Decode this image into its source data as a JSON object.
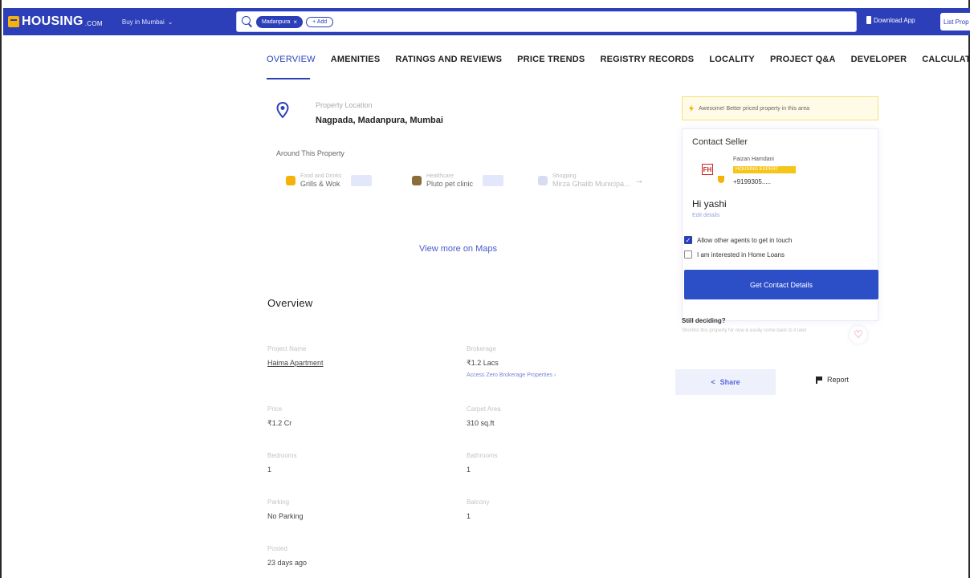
{
  "header": {
    "logo": "HOUSING",
    "logo_suffix": ".COM",
    "city_select": "Buy in Mumbai",
    "search_chip": "Madanpura",
    "search_add": "+ Add",
    "download_app": "Download App",
    "list_property": "List Prop"
  },
  "tabs": [
    {
      "label": "OVERVIEW",
      "active": true
    },
    {
      "label": "AMENITIES"
    },
    {
      "label": "RATINGS AND REVIEWS"
    },
    {
      "label": "PRICE TRENDS"
    },
    {
      "label": "REGISTRY RECORDS"
    },
    {
      "label": "LOCALITY"
    },
    {
      "label": "PROJECT Q&A"
    },
    {
      "label": "DEVELOPER"
    },
    {
      "label": "CALCULATOR"
    }
  ],
  "location": {
    "label": "Property Location",
    "value": "Nagpada, Madanpura, Mumbai",
    "around_title": "Around This Property",
    "pois": [
      {
        "category": "Food and Drinks",
        "name": "Grills & Wok"
      },
      {
        "category": "Healthcare",
        "name": "Pluto pet clinic"
      },
      {
        "category": "Shopping",
        "name": "Mirza Ghalib Municipa..."
      }
    ],
    "view_maps": "View more on Maps"
  },
  "overview": {
    "title": "Overview",
    "fields": [
      {
        "label": "Project Name",
        "value": "Haima Apartment"
      },
      {
        "label": "Brokerage",
        "value": "₹1.2 Lacs",
        "sub": "Access Zero Brokerage Properties ›"
      },
      {
        "label": "Price",
        "value": "₹1.2 Cr"
      },
      {
        "label": "Carpet Area",
        "value": "310 sq.ft"
      },
      {
        "label": "Bedrooms",
        "value": "1"
      },
      {
        "label": "Bathrooms",
        "value": "1"
      },
      {
        "label": "Parking",
        "value": "No Parking"
      },
      {
        "label": "Balcony",
        "value": "1"
      },
      {
        "label": "Posted",
        "value": "23 days ago"
      }
    ]
  },
  "sidebar": {
    "banner": "Awesome! Better priced property in this area",
    "contact_title": "Contact Seller",
    "seller_logo": "FH",
    "seller_name": "Faizan Hamdani",
    "seller_badge": "HOUSING EXPERT",
    "seller_phone": "+9199305.....",
    "greeting": "Hi yashi",
    "edit_details": "Edit details",
    "check_agents": "Allow other agents to get in touch",
    "check_loans": "I am interested in Home Loans",
    "cta": "Get Contact Details",
    "still_title": "Still deciding?",
    "still_sub": "Shortlist this property for now & easily come back to it later",
    "share": "Share",
    "report": "Report"
  },
  "colors": {
    "brand": "#2c3fb8",
    "accent_yellow": "#f5b20b",
    "heart": "#e04a86"
  }
}
